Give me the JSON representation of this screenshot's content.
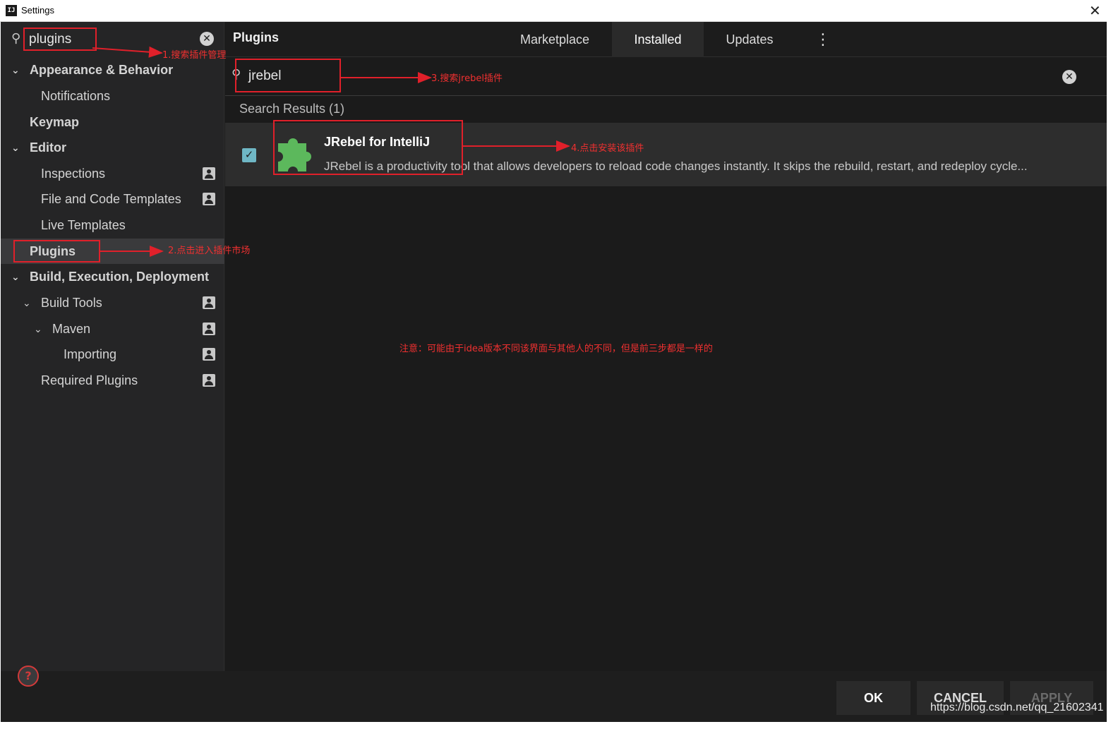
{
  "window": {
    "title": "Settings",
    "app_icon": "IJ"
  },
  "sidebar": {
    "search_value": "plugins",
    "items": [
      {
        "label": "Appearance & Behavior"
      },
      {
        "label": "Notifications"
      },
      {
        "label": "Keymap"
      },
      {
        "label": "Editor"
      },
      {
        "label": "Inspections"
      },
      {
        "label": "File and Code Templates"
      },
      {
        "label": "Live Templates"
      },
      {
        "label": "Plugins"
      },
      {
        "label": "Build, Execution, Deployment"
      },
      {
        "label": "Build Tools"
      },
      {
        "label": "Maven"
      },
      {
        "label": "Importing"
      },
      {
        "label": "Required Plugins"
      }
    ]
  },
  "plugins": {
    "title": "Plugins",
    "tabs": [
      {
        "label": "Marketplace"
      },
      {
        "label": "Installed"
      },
      {
        "label": "Updates"
      }
    ],
    "active_tab": "Installed",
    "search_value": "jrebel",
    "results_header": "Search Results (1)",
    "results": [
      {
        "name": "JRebel for IntelliJ",
        "description": "JRebel is a productivity tool that allows developers to reload code changes instantly. It skips the rebuild, restart, and redeploy cycle...",
        "enabled": true
      }
    ]
  },
  "annotations": {
    "step1": "1.搜索插件管理",
    "step2": "2.点击进入插件市场",
    "step3": "3.搜索jrebel插件",
    "step4": "4.点击安装该插件",
    "note": "注意：可能由于idea版本不同该界面与其他人的不同，但是前三步都是一样的",
    "color": "#e0202a"
  },
  "footer": {
    "ok": "OK",
    "cancel": "CANCEL",
    "apply": "APPLY",
    "help": "?"
  },
  "watermark": "https://blog.csdn.net/qq_21602341",
  "icons": {
    "search": "search-icon",
    "clear": "clear-icon",
    "chevron": "chevron-down-icon",
    "project": "project-scope-icon",
    "plugin": "puzzle-piece-icon",
    "more": "more-vertical-icon"
  },
  "colors": {
    "background": "#1e1e1e",
    "sidebar": "#252526",
    "selected": "#3a3a3c",
    "plugin_icon": "#5cb85c",
    "checkbox": "#6fb7c5"
  }
}
